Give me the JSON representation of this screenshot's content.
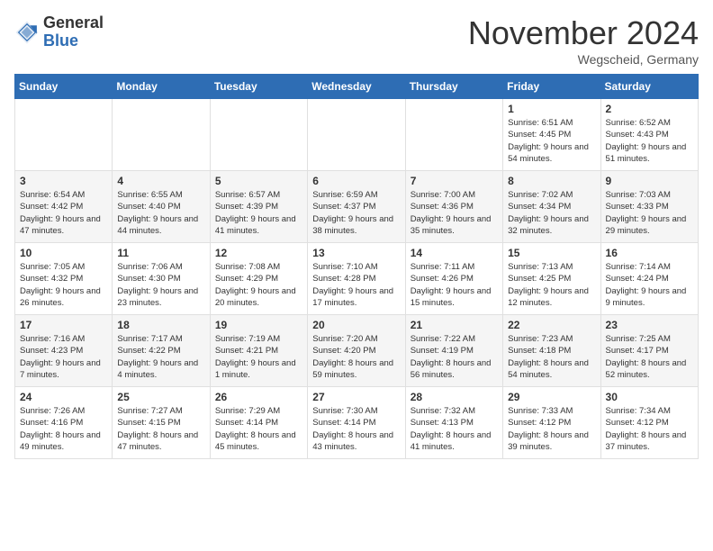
{
  "header": {
    "logo_general": "General",
    "logo_blue": "Blue",
    "month_title": "November 2024",
    "location": "Wegscheid, Germany"
  },
  "days_of_week": [
    "Sunday",
    "Monday",
    "Tuesday",
    "Wednesday",
    "Thursday",
    "Friday",
    "Saturday"
  ],
  "weeks": [
    [
      {
        "day": "",
        "info": ""
      },
      {
        "day": "",
        "info": ""
      },
      {
        "day": "",
        "info": ""
      },
      {
        "day": "",
        "info": ""
      },
      {
        "day": "",
        "info": ""
      },
      {
        "day": "1",
        "info": "Sunrise: 6:51 AM\nSunset: 4:45 PM\nDaylight: 9 hours\nand 54 minutes."
      },
      {
        "day": "2",
        "info": "Sunrise: 6:52 AM\nSunset: 4:43 PM\nDaylight: 9 hours\nand 51 minutes."
      }
    ],
    [
      {
        "day": "3",
        "info": "Sunrise: 6:54 AM\nSunset: 4:42 PM\nDaylight: 9 hours\nand 47 minutes."
      },
      {
        "day": "4",
        "info": "Sunrise: 6:55 AM\nSunset: 4:40 PM\nDaylight: 9 hours\nand 44 minutes."
      },
      {
        "day": "5",
        "info": "Sunrise: 6:57 AM\nSunset: 4:39 PM\nDaylight: 9 hours\nand 41 minutes."
      },
      {
        "day": "6",
        "info": "Sunrise: 6:59 AM\nSunset: 4:37 PM\nDaylight: 9 hours\nand 38 minutes."
      },
      {
        "day": "7",
        "info": "Sunrise: 7:00 AM\nSunset: 4:36 PM\nDaylight: 9 hours\nand 35 minutes."
      },
      {
        "day": "8",
        "info": "Sunrise: 7:02 AM\nSunset: 4:34 PM\nDaylight: 9 hours\nand 32 minutes."
      },
      {
        "day": "9",
        "info": "Sunrise: 7:03 AM\nSunset: 4:33 PM\nDaylight: 9 hours\nand 29 minutes."
      }
    ],
    [
      {
        "day": "10",
        "info": "Sunrise: 7:05 AM\nSunset: 4:32 PM\nDaylight: 9 hours\nand 26 minutes."
      },
      {
        "day": "11",
        "info": "Sunrise: 7:06 AM\nSunset: 4:30 PM\nDaylight: 9 hours\nand 23 minutes."
      },
      {
        "day": "12",
        "info": "Sunrise: 7:08 AM\nSunset: 4:29 PM\nDaylight: 9 hours\nand 20 minutes."
      },
      {
        "day": "13",
        "info": "Sunrise: 7:10 AM\nSunset: 4:28 PM\nDaylight: 9 hours\nand 17 minutes."
      },
      {
        "day": "14",
        "info": "Sunrise: 7:11 AM\nSunset: 4:26 PM\nDaylight: 9 hours\nand 15 minutes."
      },
      {
        "day": "15",
        "info": "Sunrise: 7:13 AM\nSunset: 4:25 PM\nDaylight: 9 hours\nand 12 minutes."
      },
      {
        "day": "16",
        "info": "Sunrise: 7:14 AM\nSunset: 4:24 PM\nDaylight: 9 hours\nand 9 minutes."
      }
    ],
    [
      {
        "day": "17",
        "info": "Sunrise: 7:16 AM\nSunset: 4:23 PM\nDaylight: 9 hours\nand 7 minutes."
      },
      {
        "day": "18",
        "info": "Sunrise: 7:17 AM\nSunset: 4:22 PM\nDaylight: 9 hours\nand 4 minutes."
      },
      {
        "day": "19",
        "info": "Sunrise: 7:19 AM\nSunset: 4:21 PM\nDaylight: 9 hours\nand 1 minute."
      },
      {
        "day": "20",
        "info": "Sunrise: 7:20 AM\nSunset: 4:20 PM\nDaylight: 8 hours\nand 59 minutes."
      },
      {
        "day": "21",
        "info": "Sunrise: 7:22 AM\nSunset: 4:19 PM\nDaylight: 8 hours\nand 56 minutes."
      },
      {
        "day": "22",
        "info": "Sunrise: 7:23 AM\nSunset: 4:18 PM\nDaylight: 8 hours\nand 54 minutes."
      },
      {
        "day": "23",
        "info": "Sunrise: 7:25 AM\nSunset: 4:17 PM\nDaylight: 8 hours\nand 52 minutes."
      }
    ],
    [
      {
        "day": "24",
        "info": "Sunrise: 7:26 AM\nSunset: 4:16 PM\nDaylight: 8 hours\nand 49 minutes."
      },
      {
        "day": "25",
        "info": "Sunrise: 7:27 AM\nSunset: 4:15 PM\nDaylight: 8 hours\nand 47 minutes."
      },
      {
        "day": "26",
        "info": "Sunrise: 7:29 AM\nSunset: 4:14 PM\nDaylight: 8 hours\nand 45 minutes."
      },
      {
        "day": "27",
        "info": "Sunrise: 7:30 AM\nSunset: 4:14 PM\nDaylight: 8 hours\nand 43 minutes."
      },
      {
        "day": "28",
        "info": "Sunrise: 7:32 AM\nSunset: 4:13 PM\nDaylight: 8 hours\nand 41 minutes."
      },
      {
        "day": "29",
        "info": "Sunrise: 7:33 AM\nSunset: 4:12 PM\nDaylight: 8 hours\nand 39 minutes."
      },
      {
        "day": "30",
        "info": "Sunrise: 7:34 AM\nSunset: 4:12 PM\nDaylight: 8 hours\nand 37 minutes."
      }
    ]
  ]
}
